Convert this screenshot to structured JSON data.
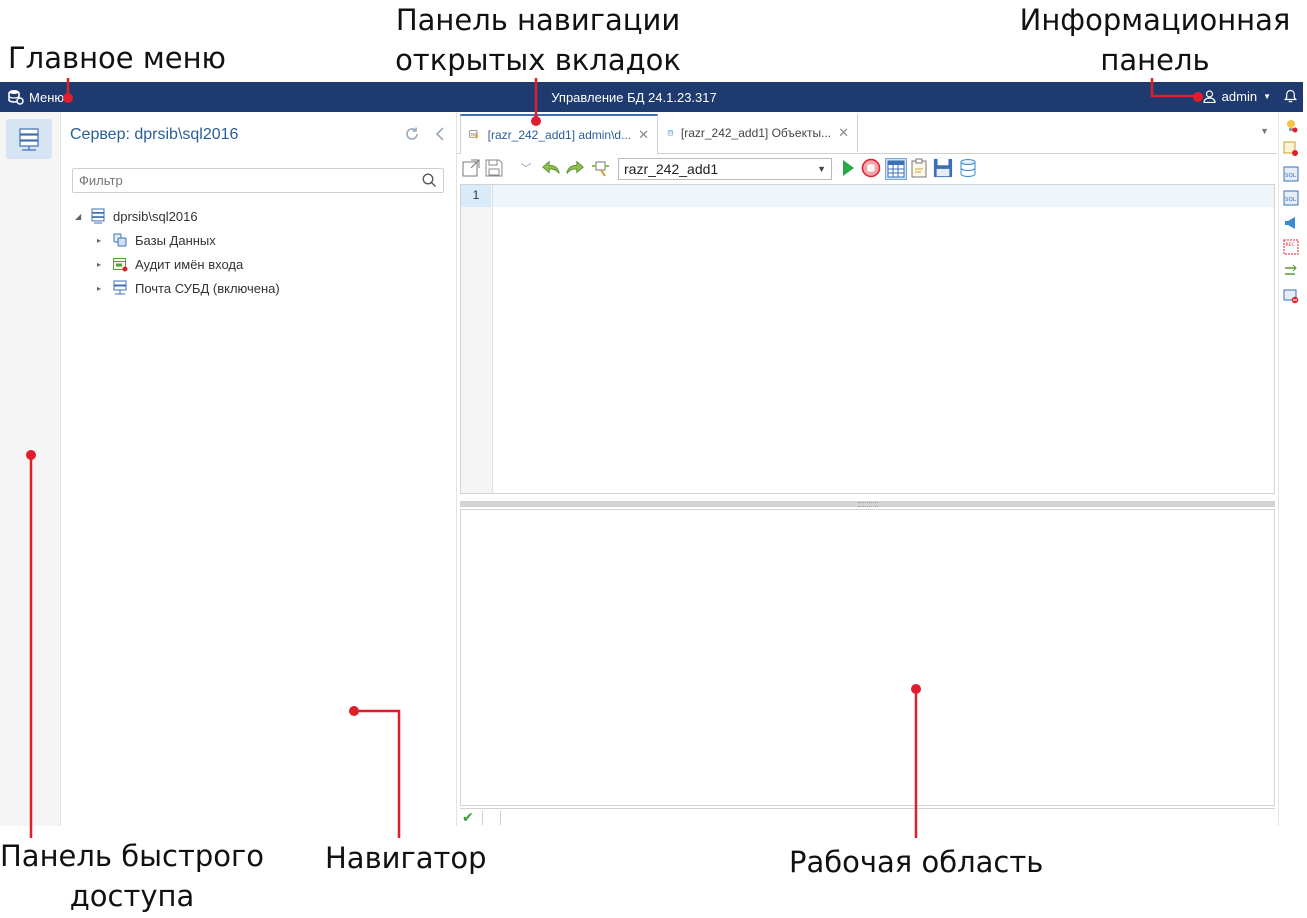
{
  "captions": {
    "main_menu": "Главное меню",
    "tabs_nav": "Панель навигации открытых вкладок",
    "info": "Информационная панель",
    "quick": "Панель быстрого доступа",
    "navigator": "Навигатор",
    "workspace": "Рабочая область"
  },
  "titlebar": {
    "menu_label": "Меню",
    "title": "Управление БД 24.1.23.317",
    "user": "admin"
  },
  "navigator": {
    "title": "Сервер: dprsib\\sql2016",
    "filter_placeholder": "Фильтр",
    "tree": {
      "root": "dprsib\\sql2016",
      "children": [
        "Базы Данных",
        "Аудит имён входа",
        "Почта СУБД (включена)"
      ]
    }
  },
  "workspace": {
    "tabs": [
      {
        "label": "[razr_242_add1] admin\\d..."
      },
      {
        "label": "[razr_242_add1] Объекты..."
      }
    ],
    "database": "razr_242_add1",
    "line_number": "1"
  },
  "colors": {
    "titlebar": "#1e3a6e",
    "accent": "#2b5d98",
    "marker": "#e01e2b"
  }
}
